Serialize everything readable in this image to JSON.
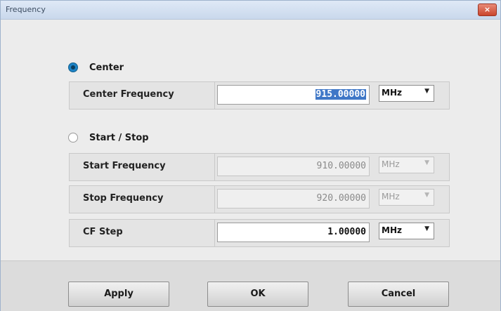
{
  "window": {
    "title": "Frequency",
    "close_label": "×"
  },
  "center_mode": {
    "label": "Center",
    "selected": true
  },
  "center_frequency": {
    "label": "Center Frequency",
    "value": "915.00000",
    "unit": "MHz"
  },
  "startstop_mode": {
    "label": "Start / Stop",
    "selected": false
  },
  "start_frequency": {
    "label": "Start Frequency",
    "value": "910.00000",
    "unit": "MHz"
  },
  "stop_frequency": {
    "label": "Stop Frequency",
    "value": "920.00000",
    "unit": "MHz"
  },
  "cf_step": {
    "label": "CF Step",
    "value": "1.00000",
    "unit": "MHz"
  },
  "buttons": {
    "apply": "Apply",
    "ok": "OK",
    "cancel": "Cancel"
  },
  "icons": {
    "dropdown": "chevron-down-icon",
    "close": "close-icon"
  },
  "colors": {
    "radio_checked": "#1d83c6",
    "selection": "#3f77c7",
    "titlebar": "#c9d8ec",
    "close_button": "#c9452d"
  }
}
